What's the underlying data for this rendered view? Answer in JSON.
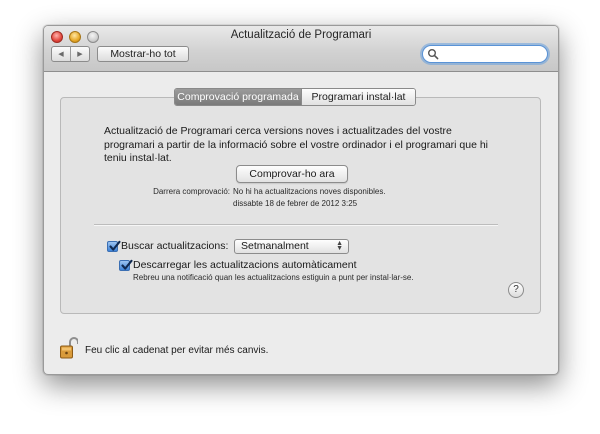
{
  "window": {
    "title": "Actualització de Programari",
    "show_all_label": "Mostrar-ho tot",
    "nav": {
      "back_glyph": "◀",
      "forward_glyph": "▶"
    },
    "search": {
      "placeholder": "",
      "value": ""
    }
  },
  "tabs": [
    {
      "label": "Comprovació programada",
      "selected": true
    },
    {
      "label": "Programari instal·lat",
      "selected": false
    }
  ],
  "main": {
    "description": "Actualització de Programari cerca versions noves i actualitzades del vostre programari a partir de la informació sobre el vostre ordinador i el programari que hi teniu instal·lat.",
    "check_now_label": "Comprovar-ho ara",
    "last_check_label": "Darrera comprovació:",
    "last_check_status": "No hi ha actualitzacions noves disponibles.",
    "last_check_date": "dissabte 18 de febrer de 2012 3:25",
    "check_updates": {
      "label": "Buscar actualitzacions:",
      "checked": true
    },
    "frequency": {
      "selected": "Setmanalment",
      "arrows": "⌃⌄"
    },
    "auto_download": {
      "label": "Descarregar les actualitzacions automàticament",
      "checked": true,
      "note": "Rebreu una notificació quan les actualitzacions estiguin a punt per instal·lar-se."
    },
    "help_glyph": "?"
  },
  "footer": {
    "lock_text": "Feu clic al cadenat per evitar més canvis."
  },
  "colors": {
    "accent": "#3e83d8",
    "window_bg": "#ececec",
    "group_bg": "#e3e3e3",
    "tab_selected": "#8a8a8a"
  },
  "icons": [
    "search-icon",
    "checkmark-icon",
    "lock-icon",
    "help-icon"
  ]
}
